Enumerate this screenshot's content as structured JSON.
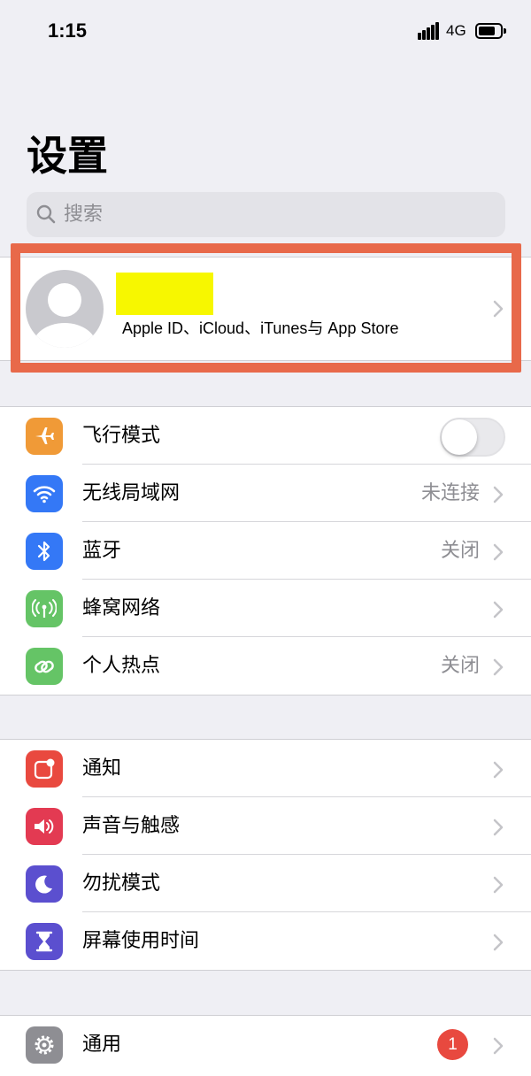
{
  "status_bar": {
    "time": "1:15",
    "network": "4G"
  },
  "title": "设置",
  "search": {
    "placeholder": "搜索"
  },
  "account": {
    "subtitle": "Apple ID、iCloud、iTunes与 App Store"
  },
  "colors": {
    "highlight": "#e8694a",
    "airplane": "#f09a37",
    "wifi": "#3478f6",
    "bluetooth": "#3478f6",
    "cellular": "#65c466",
    "hotspot": "#65c466",
    "notifications": "#e9493f",
    "sounds": "#e33a52",
    "dnd": "#5b4fcf",
    "screen_time": "#5b4fcf",
    "general": "#8e8e93",
    "badge": "#e8493f"
  },
  "group1": {
    "airplane": {
      "label": "飞行模式",
      "icon": "airplane-icon",
      "toggle_on": false
    },
    "wifi": {
      "label": "无线局域网",
      "value": "未连接",
      "icon": "wifi-icon"
    },
    "bluetooth": {
      "label": "蓝牙",
      "value": "关闭",
      "icon": "bluetooth-icon"
    },
    "cellular": {
      "label": "蜂窝网络",
      "icon": "antenna-icon"
    },
    "hotspot": {
      "label": "个人热点",
      "value": "关闭",
      "icon": "hotspot-icon"
    }
  },
  "group2": {
    "notifications": {
      "label": "通知",
      "icon": "notification-icon"
    },
    "sounds": {
      "label": "声音与触感",
      "icon": "speaker-icon"
    },
    "dnd": {
      "label": "勿扰模式",
      "icon": "moon-icon"
    },
    "screen_time": {
      "label": "屏幕使用时间",
      "icon": "hourglass-icon"
    }
  },
  "group3": {
    "general": {
      "label": "通用",
      "icon": "gear-icon",
      "badge": "1"
    }
  }
}
